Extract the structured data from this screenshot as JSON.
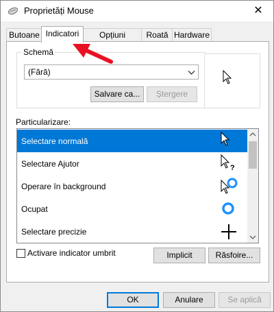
{
  "window": {
    "title": "Proprietăți Mouse",
    "close_label": "✕"
  },
  "tabs": [
    {
      "label": "Butoane"
    },
    {
      "label": "Indicatori"
    },
    {
      "label": "Opțiuni indicatori"
    },
    {
      "label": "Roată"
    },
    {
      "label": "Hardware"
    }
  ],
  "scheme": {
    "group_label": "Schemă",
    "selected_value": "(Fără)",
    "save_label": "Salvare ca...",
    "delete_label": "Ștergere"
  },
  "customize": {
    "label": "Particularizare:",
    "rows": [
      {
        "label": "Selectare normală",
        "icon": "arrow-cursor-icon"
      },
      {
        "label": "Selectare Ajutor",
        "icon": "help-cursor-icon"
      },
      {
        "label": "Operare în background",
        "icon": "working-in-background-cursor-icon"
      },
      {
        "label": "Ocupat",
        "icon": "busy-cursor-icon"
      },
      {
        "label": "Selectare precizie",
        "icon": "precision-cursor-icon"
      }
    ],
    "selected_index": 0
  },
  "shadow": {
    "label": "Activare indicator umbrit",
    "checked": false
  },
  "actions": {
    "default_label": "Implicit",
    "browse_label": "Răsfoire..."
  },
  "footer": {
    "ok_label": "OK",
    "cancel_label": "Anulare",
    "apply_label": "Se aplică"
  },
  "colors": {
    "accent": "#0078d7",
    "annotation": "#e81123"
  }
}
